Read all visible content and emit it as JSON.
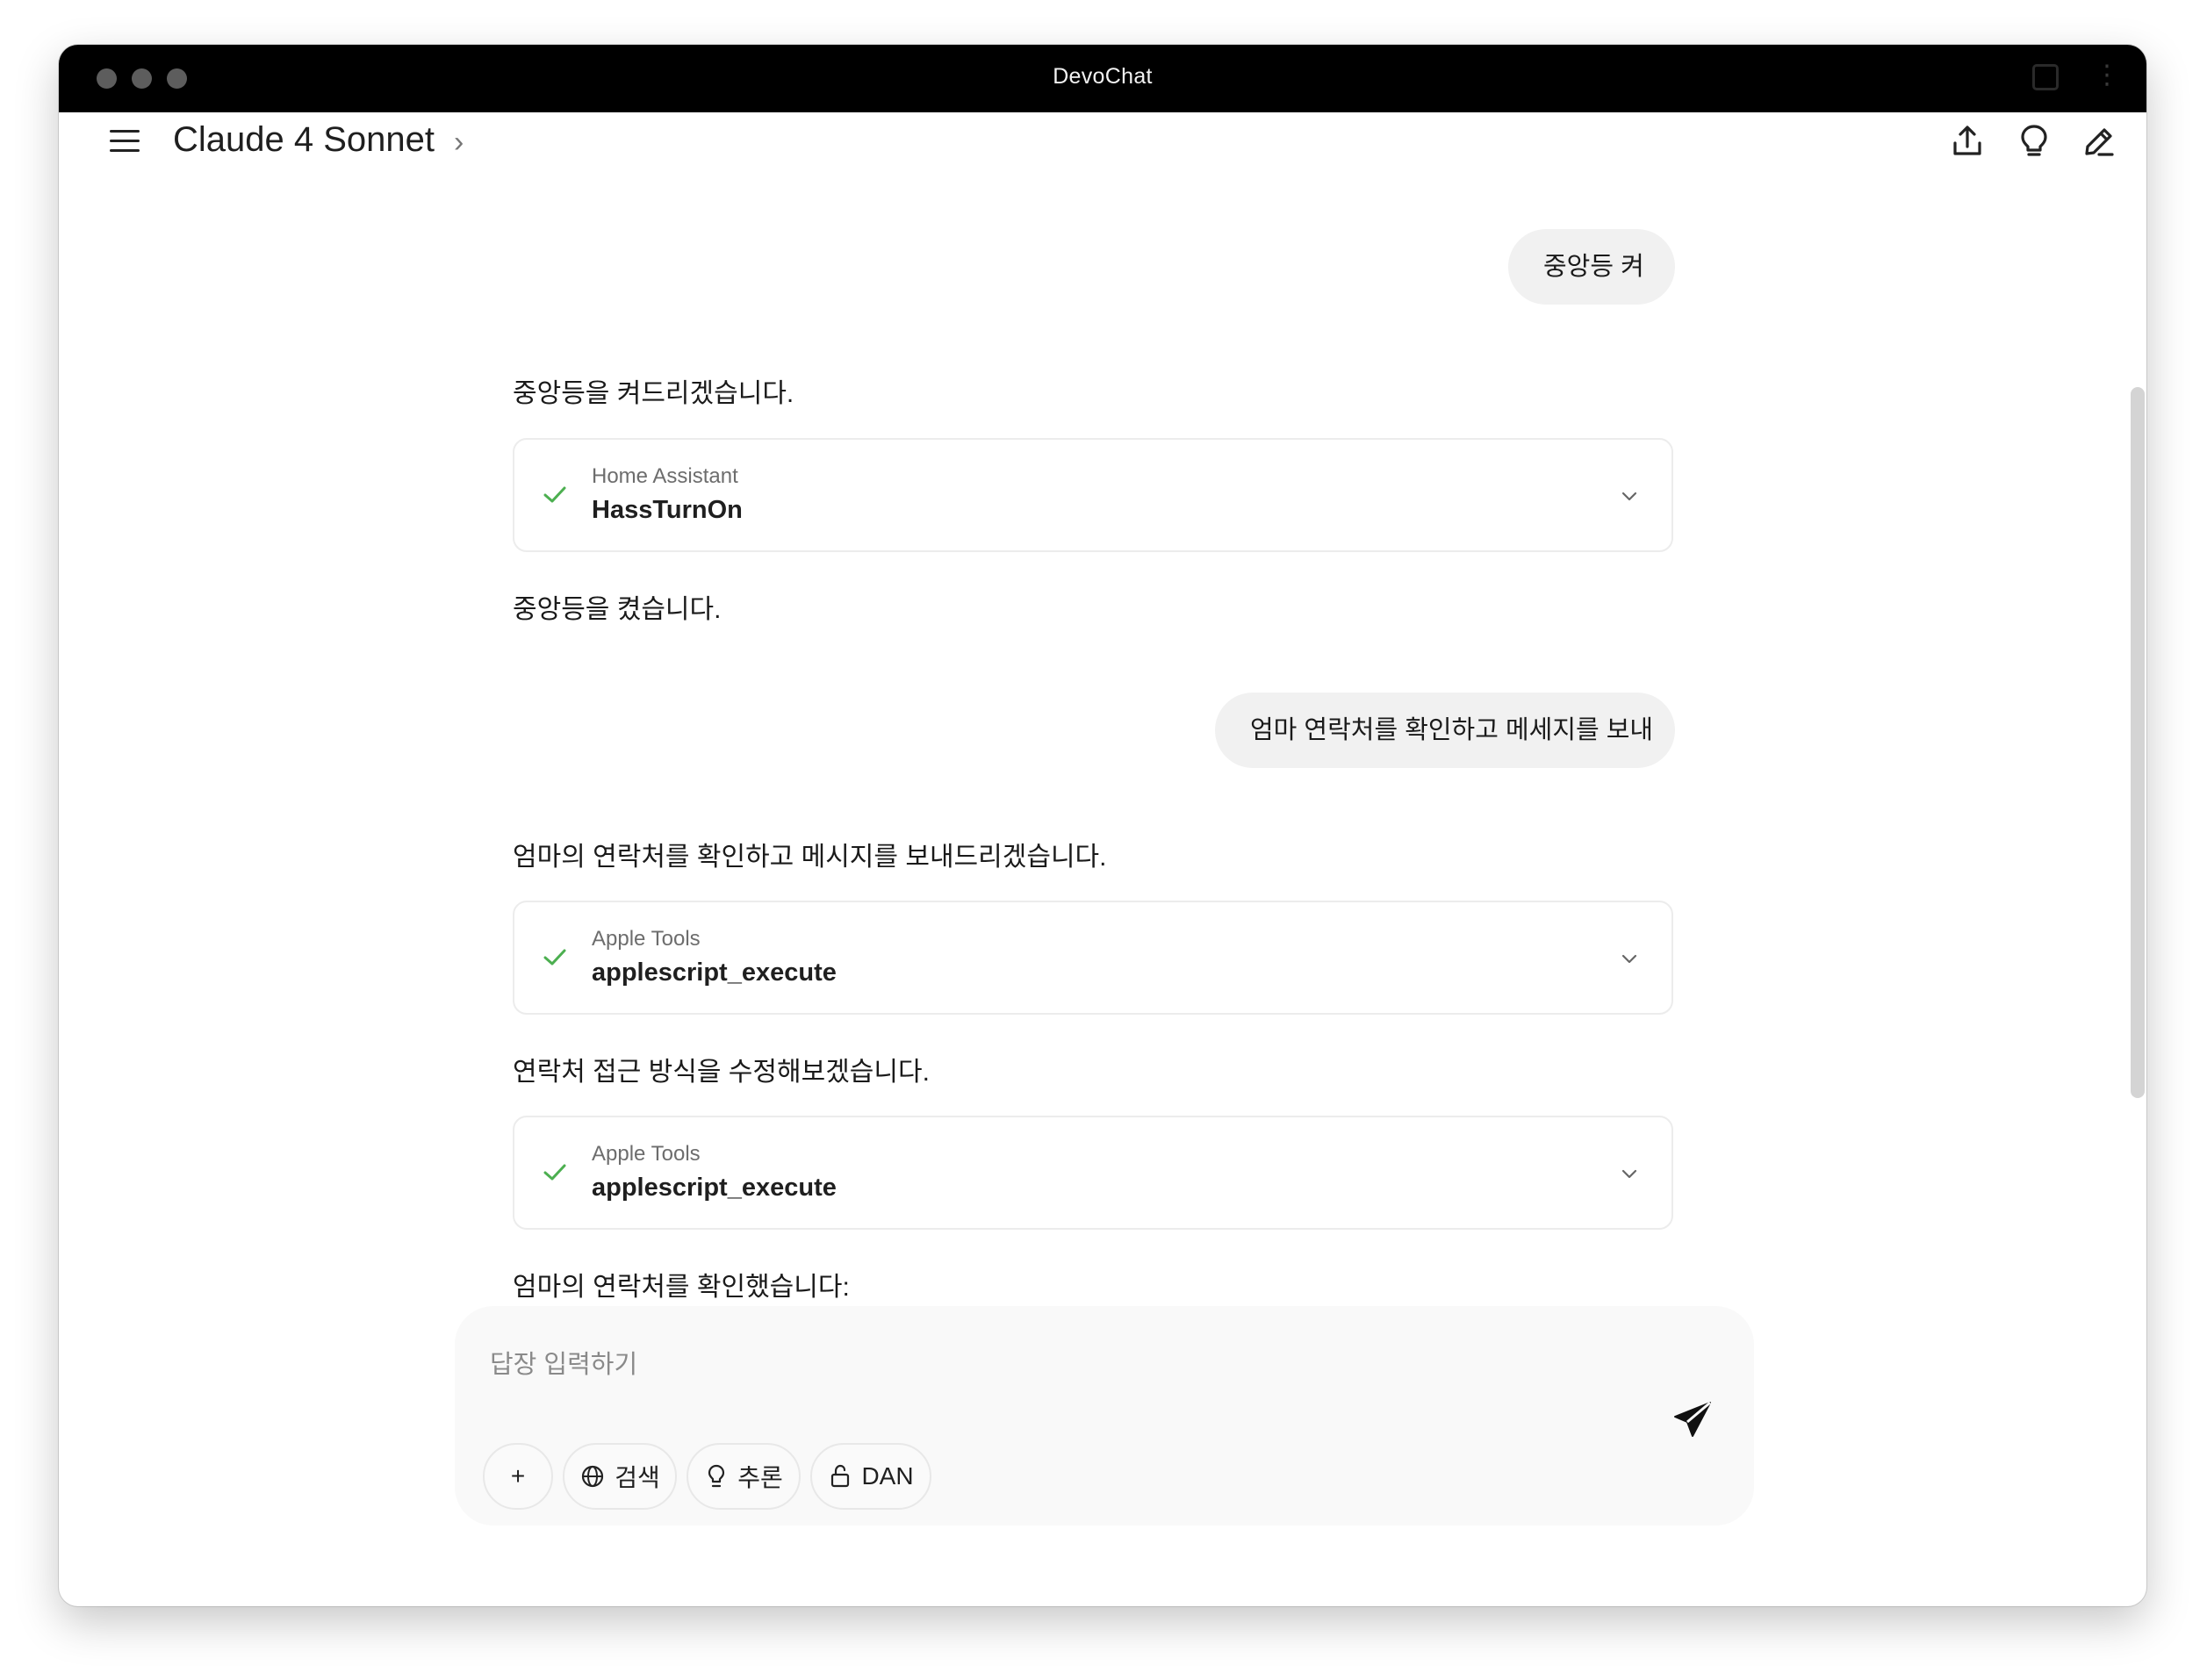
{
  "window": {
    "title": "DevoChat"
  },
  "header": {
    "model_name": "Claude 4 Sonnet",
    "icons": [
      "share-icon",
      "lightbulb-icon",
      "edit-icon"
    ]
  },
  "conversation": {
    "user_message_1": "중앙등 켜",
    "assistant_1_intro": "중앙등을 켜드리겠습니다.",
    "tool_1": {
      "source": "Home Assistant",
      "name": "HassTurnOn",
      "status": "success"
    },
    "assistant_1_result": "중앙등을 켰습니다.",
    "user_message_2": "엄마 연락처를 확인하고 메세지를 보내",
    "assistant_2_intro": "엄마의 연락처를 확인하고 메시지를 보내드리겠습니다.",
    "tool_2": {
      "source": "Apple Tools",
      "name": "applescript_execute",
      "status": "success"
    },
    "assistant_2_retry": "연락처 접근 방식을 수정해보겠습니다.",
    "tool_3": {
      "source": "Apple Tools",
      "name": "applescript_execute",
      "status": "success"
    },
    "assistant_2_result": "엄마의 연락처를 확인했습니다:"
  },
  "composer": {
    "placeholder": "답장 입력하기",
    "buttons": {
      "add": "+",
      "search": "검색",
      "reasoning": "추론",
      "dan": "DAN"
    }
  },
  "colors": {
    "accent_check": "#4caf50",
    "titlebar": "#000000",
    "bubble": "#f1f1f1"
  }
}
